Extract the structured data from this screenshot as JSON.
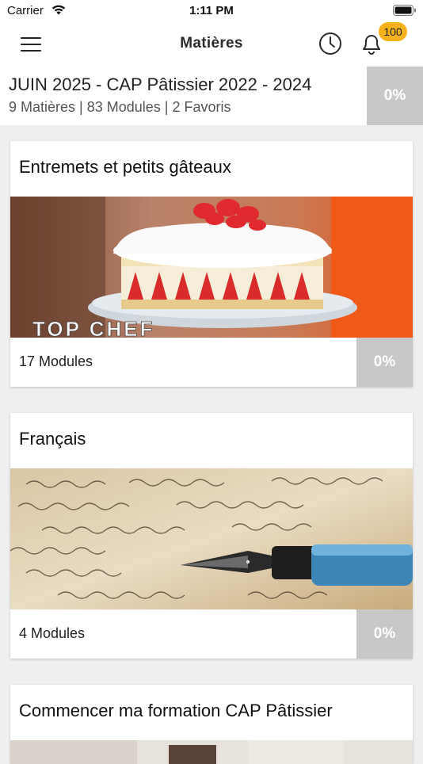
{
  "status_bar": {
    "carrier": "Carrier",
    "time": "1:11 PM"
  },
  "header": {
    "title": "Matières",
    "notification_count": "100"
  },
  "summary": {
    "title": "JUIN 2025 - CAP Pâtissier 2022 - 2024",
    "subtitle": "9 Matières | 83 Modules | 2 Favoris",
    "progress": "0%"
  },
  "cards": [
    {
      "title": "Entremets et petits gâteaux",
      "modules": "17 Modules",
      "progress": "0%",
      "image_text": "TOP CHEF"
    },
    {
      "title": "Français",
      "modules": "4 Modules",
      "progress": "0%"
    },
    {
      "title": "Commencer ma formation CAP Pâtissier"
    }
  ],
  "colors": {
    "badge": "#f5b11c",
    "progress_bg": "#c8c8c8",
    "background": "#efefef"
  }
}
